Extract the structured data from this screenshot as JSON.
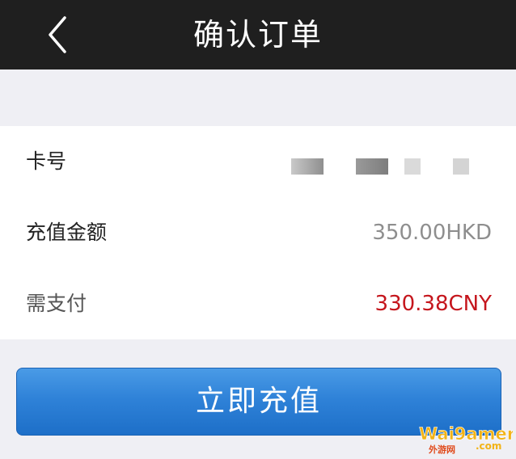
{
  "header": {
    "title": "确认订单"
  },
  "order": {
    "card_label": "卡号",
    "amount_label": "充值金额",
    "amount_value": "350.00HKD",
    "pay_label": "需支付",
    "pay_value": "330.38CNY"
  },
  "actions": {
    "recharge_label": "立即充值"
  },
  "watermark": {
    "text_main": "Wai9amer",
    "text_com": ".com",
    "text_cn": "外游网"
  },
  "colors": {
    "header_bg": "#1f1f1f",
    "accent_blue": "#2f82d8",
    "price_red": "#c5161d"
  }
}
